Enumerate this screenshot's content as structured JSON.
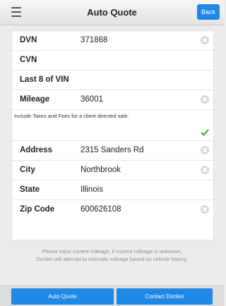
{
  "header": {
    "title": "Auto Quote",
    "back_label": "Back"
  },
  "form": {
    "dvn": {
      "label": "DVN",
      "value": "371868"
    },
    "cvn": {
      "label": "CVN",
      "value": ""
    },
    "vin8": {
      "label": "Last 8 of VIN",
      "value": ""
    },
    "mileage": {
      "label": "Mileage",
      "value": "36001"
    },
    "note": "Include Taxes and Fees for a client directed sale.",
    "note_checked": true,
    "address": {
      "label": "Address",
      "value": "2315 Sanders Rd"
    },
    "city": {
      "label": "City",
      "value": "Northbrook"
    },
    "state": {
      "label": "State",
      "value": "Illinois"
    },
    "zip": {
      "label": "Zip Code",
      "value": "600626108"
    }
  },
  "info_text": {
    "line1": "Please input current mileage, if current mileage is unknown,",
    "line2": "Donlen will attempt to estimate mileage based on vehicle history."
  },
  "footer": {
    "auto_quote_label": "Auto Quote",
    "contact_label": "Contact Donlen"
  },
  "icons": {
    "menu": "menu-icon",
    "clear": "clear-icon",
    "check": "check-icon"
  },
  "colors": {
    "accent": "#1e88e5",
    "check": "#22b322"
  }
}
